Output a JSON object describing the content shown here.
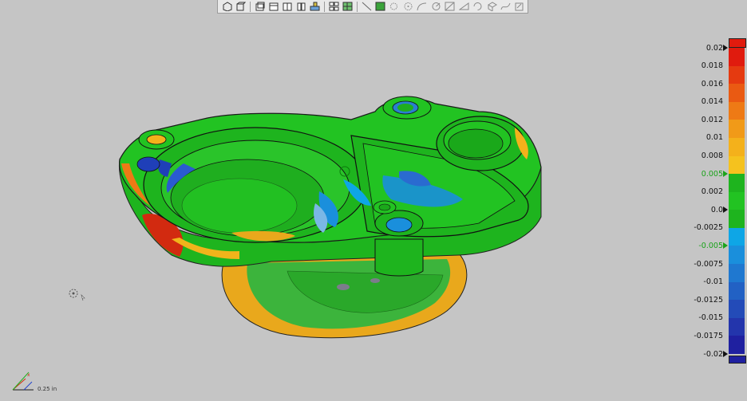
{
  "toolbar": {
    "buttons": [
      {
        "name": "view-iso-icon"
      },
      {
        "name": "view-box-icon"
      },
      {
        "name": "sep"
      },
      {
        "name": "view-front-icon"
      },
      {
        "name": "view-top-icon"
      },
      {
        "name": "view-side-icon"
      },
      {
        "name": "view-right-icon"
      },
      {
        "name": "view-bottom-icon"
      },
      {
        "name": "sep"
      },
      {
        "name": "layout-grid-icon"
      },
      {
        "name": "layout-select-icon"
      },
      {
        "name": "sep"
      },
      {
        "name": "line-tool-icon"
      },
      {
        "name": "face-select-icon"
      },
      {
        "name": "point-select-icon"
      },
      {
        "name": "circle-select-icon"
      },
      {
        "name": "arc-tool-icon"
      },
      {
        "name": "curve-tool-icon"
      },
      {
        "name": "measure-tool-icon"
      },
      {
        "name": "sweep-tool-icon"
      },
      {
        "name": "rotate-tool-icon"
      },
      {
        "name": "fill-tool-icon"
      },
      {
        "name": "freeform-tool-icon"
      },
      {
        "name": "export-tool-icon"
      }
    ]
  },
  "legend": {
    "ticks": [
      {
        "label": "0.02",
        "arrow": true,
        "tol": false
      },
      {
        "label": "0.018",
        "arrow": false,
        "tol": false
      },
      {
        "label": "0.016",
        "arrow": false,
        "tol": false
      },
      {
        "label": "0.014",
        "arrow": false,
        "tol": false
      },
      {
        "label": "0.012",
        "arrow": false,
        "tol": false
      },
      {
        "label": "0.01",
        "arrow": false,
        "tol": false
      },
      {
        "label": "0.008",
        "arrow": false,
        "tol": false
      },
      {
        "label": "0.005",
        "arrow": true,
        "tol": true
      },
      {
        "label": "0.002",
        "arrow": false,
        "tol": false
      },
      {
        "label": "0.0",
        "arrow": true,
        "tol": false
      },
      {
        "label": "-0.0025",
        "arrow": false,
        "tol": false
      },
      {
        "label": "-0.005",
        "arrow": true,
        "tol": true
      },
      {
        "label": "-0.0075",
        "arrow": false,
        "tol": false
      },
      {
        "label": "-0.01",
        "arrow": false,
        "tol": false
      },
      {
        "label": "-0.0125",
        "arrow": false,
        "tol": false
      },
      {
        "label": "-0.015",
        "arrow": false,
        "tol": false
      },
      {
        "label": "-0.0175",
        "arrow": false,
        "tol": false
      },
      {
        "label": "-0.02",
        "arrow": true,
        "tol": false
      }
    ],
    "colors": [
      "#e01b0e",
      "#e53a10",
      "#ea5a12",
      "#ee7a15",
      "#f19a18",
      "#f4b11b",
      "#f5c21e",
      "#1eb41e",
      "#22c322",
      "#1eb41e",
      "#0ea6e6",
      "#1a8fdc",
      "#1f78d0",
      "#2261c4",
      "#234bb8",
      "#2335ac",
      "#1f20a0"
    ]
  },
  "scale_label": "0.25 in"
}
